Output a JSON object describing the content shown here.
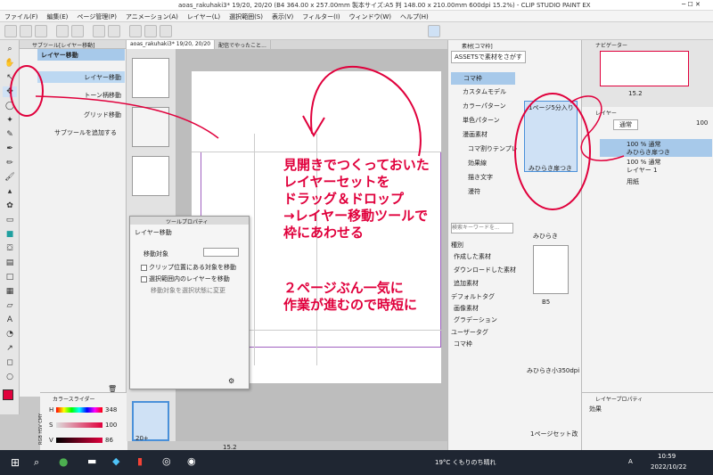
{
  "window": {
    "title": "aoas_rakuhaki3* 19/20, 20/20 (B4 364.00 x 257.00mm 製本サイズ:A5 判 148.00 x 210.00mm 600dpi 15.2%) - CLIP STUDIO PAINT EX"
  },
  "menu": [
    "ファイル(F)",
    "編集(E)",
    "ページ管理(P)",
    "アニメーション(A)",
    "レイヤー(L)",
    "選択範囲(S)",
    "表示(V)",
    "フィルター(I)",
    "ウィンドウ(W)",
    "ヘルプ(H)"
  ],
  "subtool": {
    "header": "サブツール[レイヤー移動]",
    "group": "レイヤー移動",
    "items": [
      "レイヤー移動",
      "トーン柄移動",
      "グリッド移動"
    ],
    "add": "サブツールを追加する"
  },
  "tabs": [
    "aoas_rakuhaki3* 19/20, 20/20",
    "配信でやったこと..."
  ],
  "toolprop": {
    "header": "ツールプロパティ",
    "title": "レイヤー移動",
    "target_label": "移動対象",
    "opt1": "クリップ位置にある対象を移動",
    "opt2": "選択範囲内のレイヤーを移動",
    "opt3": "移動対象を選択状態に変更"
  },
  "color": {
    "header": "カラースライダー",
    "rows": [
      {
        "label": "H",
        "value": "348"
      },
      {
        "label": "S",
        "value": "100"
      },
      {
        "label": "V",
        "value": "86"
      }
    ],
    "modes": "RGB HSV CMY"
  },
  "thumb_footer": "20+",
  "zoom": "15.2",
  "material": {
    "header": "素材[コマ枠]",
    "assets": "ASSETSで素材をさがす",
    "tree": [
      "コマ枠",
      "カスタムモデル",
      "カラーパターン",
      "単色パターン",
      "漫画素材",
      "コマ割りテンプレ",
      "効果線",
      "描き文字",
      "漫符"
    ],
    "search_placeholder": "検索キーワードを...",
    "types_header": "種別",
    "types": [
      "作成した素材",
      "ダウンロードした素材",
      "追加素材"
    ],
    "default_tag": "デフォルトタグ",
    "tags": [
      "画像素材",
      "グラデーション"
    ],
    "user_tag": "ユーザータグ",
    "user_tags": [
      "コマ枠"
    ],
    "cards": [
      "1ページ5分入り",
      "みひらき扉つき",
      "みひらき",
      "B5",
      "みひらき小350dpi",
      "1ページセット改"
    ]
  },
  "navigator": {
    "header": "ナビゲーター",
    "zoom": "15.2"
  },
  "layer": {
    "header": "レイヤー",
    "blend": "通常",
    "opacity": "100",
    "rows": [
      {
        "pct": "100 % 通常",
        "name": "みひらき扉つき"
      },
      {
        "pct": "100 % 通常",
        "name": "レイヤー 1"
      },
      {
        "pct": "",
        "name": "用紙"
      }
    ]
  },
  "layerprop": {
    "header": "レイヤープロパティ",
    "effect": "効果"
  },
  "overlay": {
    "block1": [
      "見開きでつくっておいた",
      "レイヤーセットを",
      "ドラッグ＆ドロップ",
      "→レイヤー移動ツールで",
      "枠にあわせる"
    ],
    "block2": [
      "２ページぶん一気に",
      "作業が進むので時短に"
    ],
    "color": "#e0003c"
  },
  "taskbar": {
    "weather": "19°C くもりのち晴れ",
    "lang": "A",
    "time": "10:59",
    "date": "2022/10/22"
  }
}
